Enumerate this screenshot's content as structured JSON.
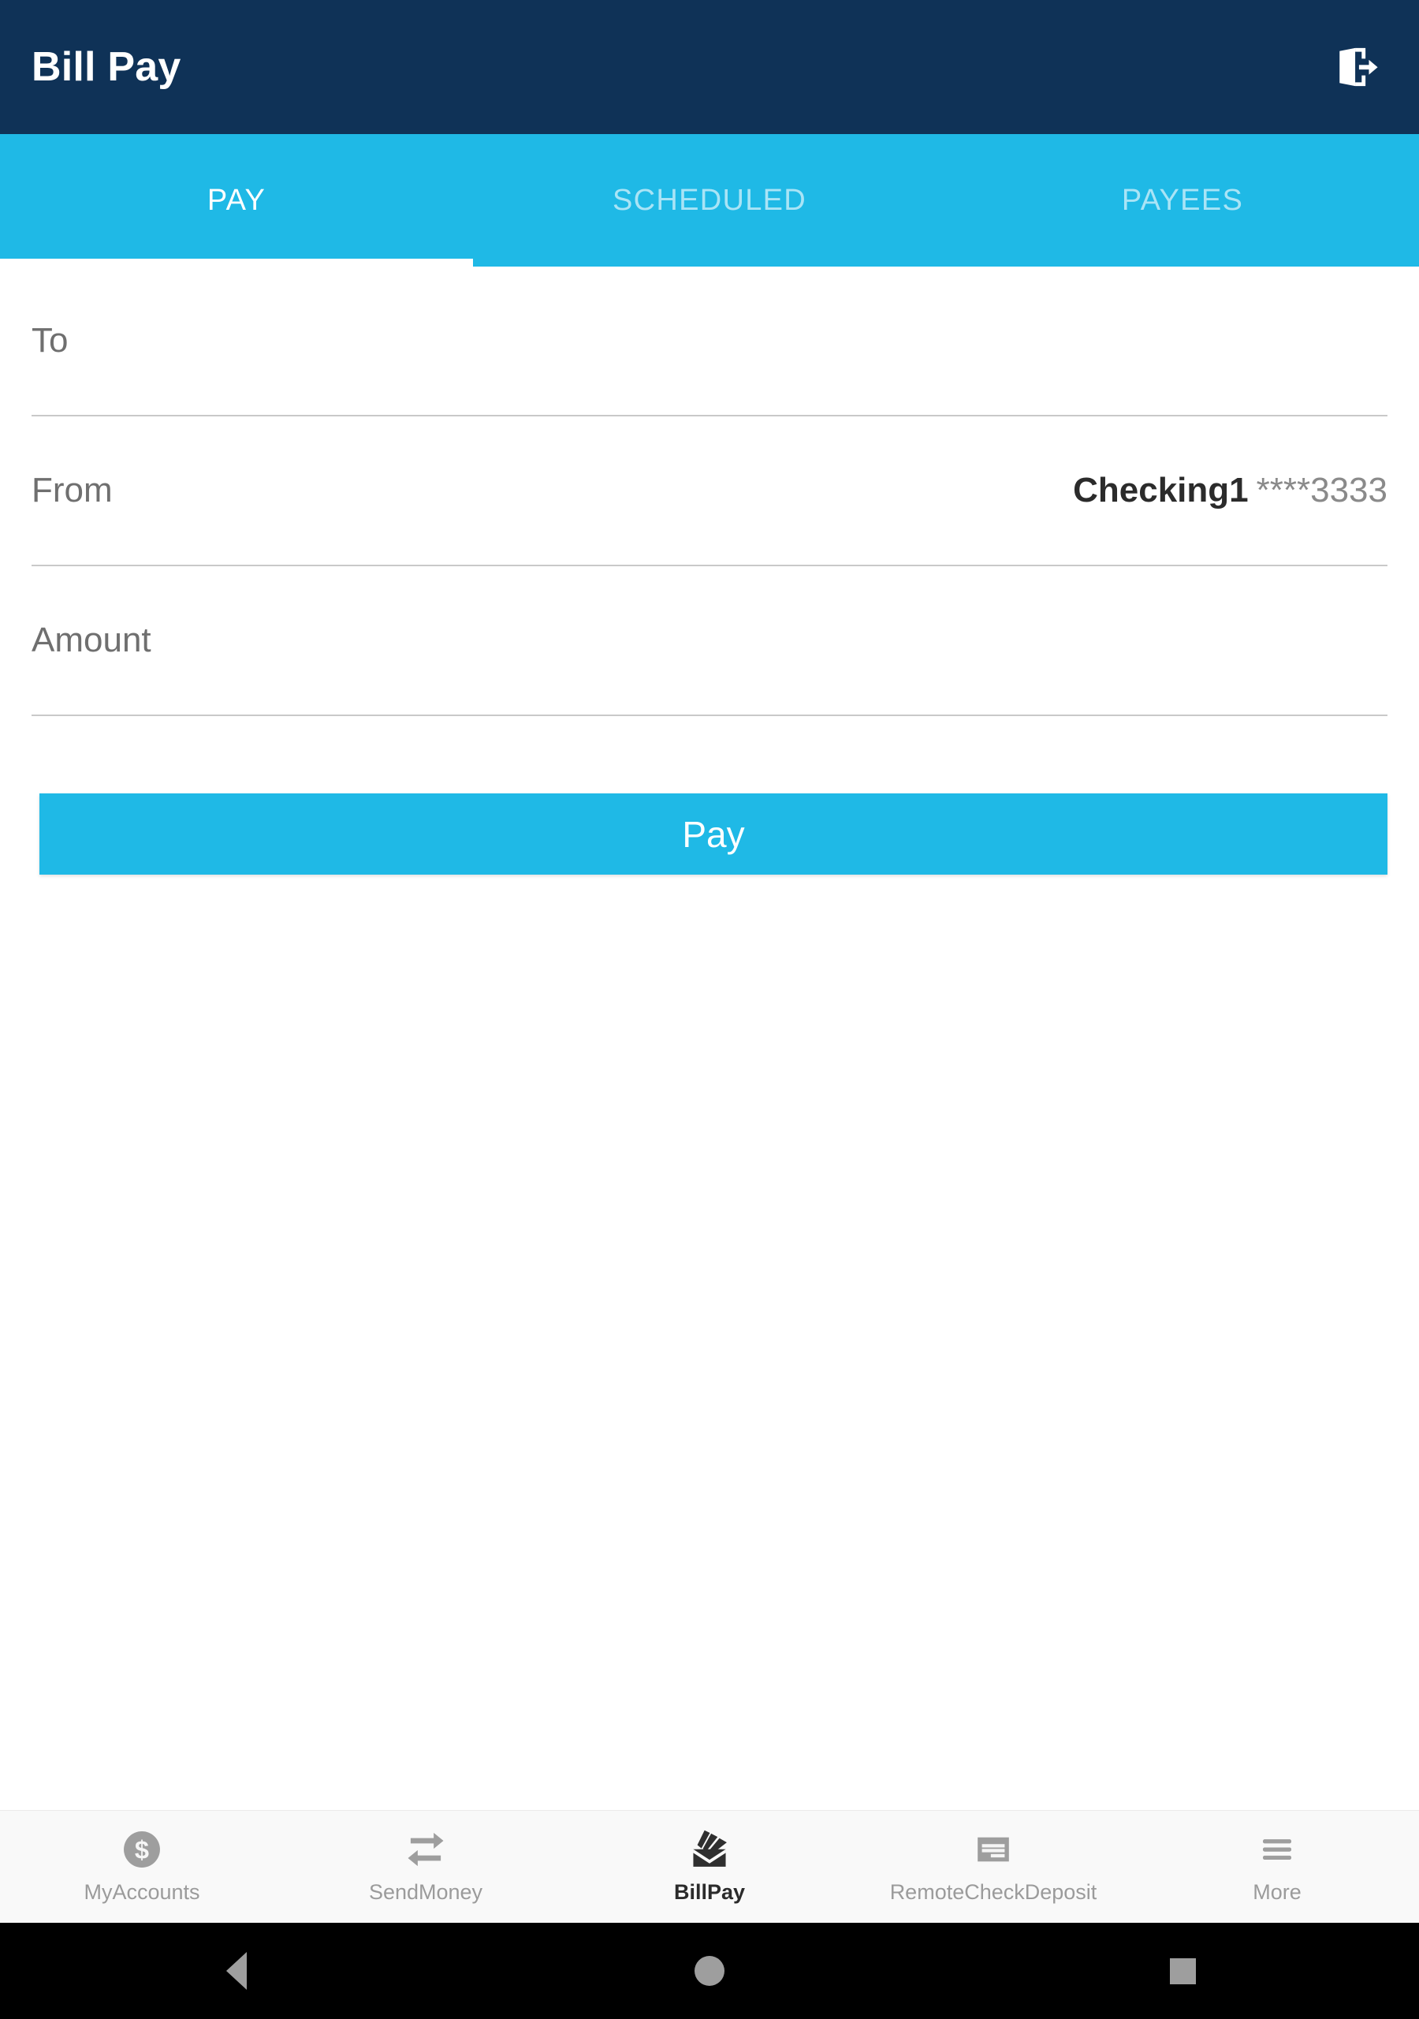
{
  "app": {
    "title": "Bill Pay",
    "logout_icon": "logout-exit-icon"
  },
  "tabs": [
    {
      "label": "PAY",
      "active": true
    },
    {
      "label": "SCHEDULED",
      "active": false
    },
    {
      "label": "PAYEES",
      "active": false
    }
  ],
  "form": {
    "to": {
      "label": "To",
      "value": "",
      "placeholder": ""
    },
    "from": {
      "label": "From",
      "account_name": "Checking1",
      "account_mask": "****3333"
    },
    "amount": {
      "label": "Amount",
      "value": "",
      "placeholder": ""
    },
    "submit_label": "Pay"
  },
  "bottom_nav": [
    {
      "label": "MyAccounts",
      "icon": "dollar-coin-icon",
      "active": false
    },
    {
      "label": "SendMoney",
      "icon": "transfer-arrows-icon",
      "active": false
    },
    {
      "label": "BillPay",
      "icon": "envelope-documents-icon",
      "active": true
    },
    {
      "label": "RemoteCheckDeposit",
      "icon": "check-card-icon",
      "active": false
    },
    {
      "label": "More",
      "icon": "hamburger-menu-icon",
      "active": false
    }
  ],
  "system_nav": [
    {
      "name": "back",
      "icon": "triangle-back-icon"
    },
    {
      "name": "home",
      "icon": "circle-home-icon"
    },
    {
      "name": "recents",
      "icon": "square-recents-icon"
    }
  ],
  "colors": {
    "appbar_bg": "#0f3257",
    "accent": "#1fb9e6",
    "page_bg": "#ffffff",
    "bottomnav_bg": "#f9f9f9",
    "sysbar_bg": "#000000",
    "label_text": "#6f6f6f",
    "value_text": "#2b2b2b",
    "muted_text": "#8a8a8a",
    "divider": "#c9c9c9"
  }
}
